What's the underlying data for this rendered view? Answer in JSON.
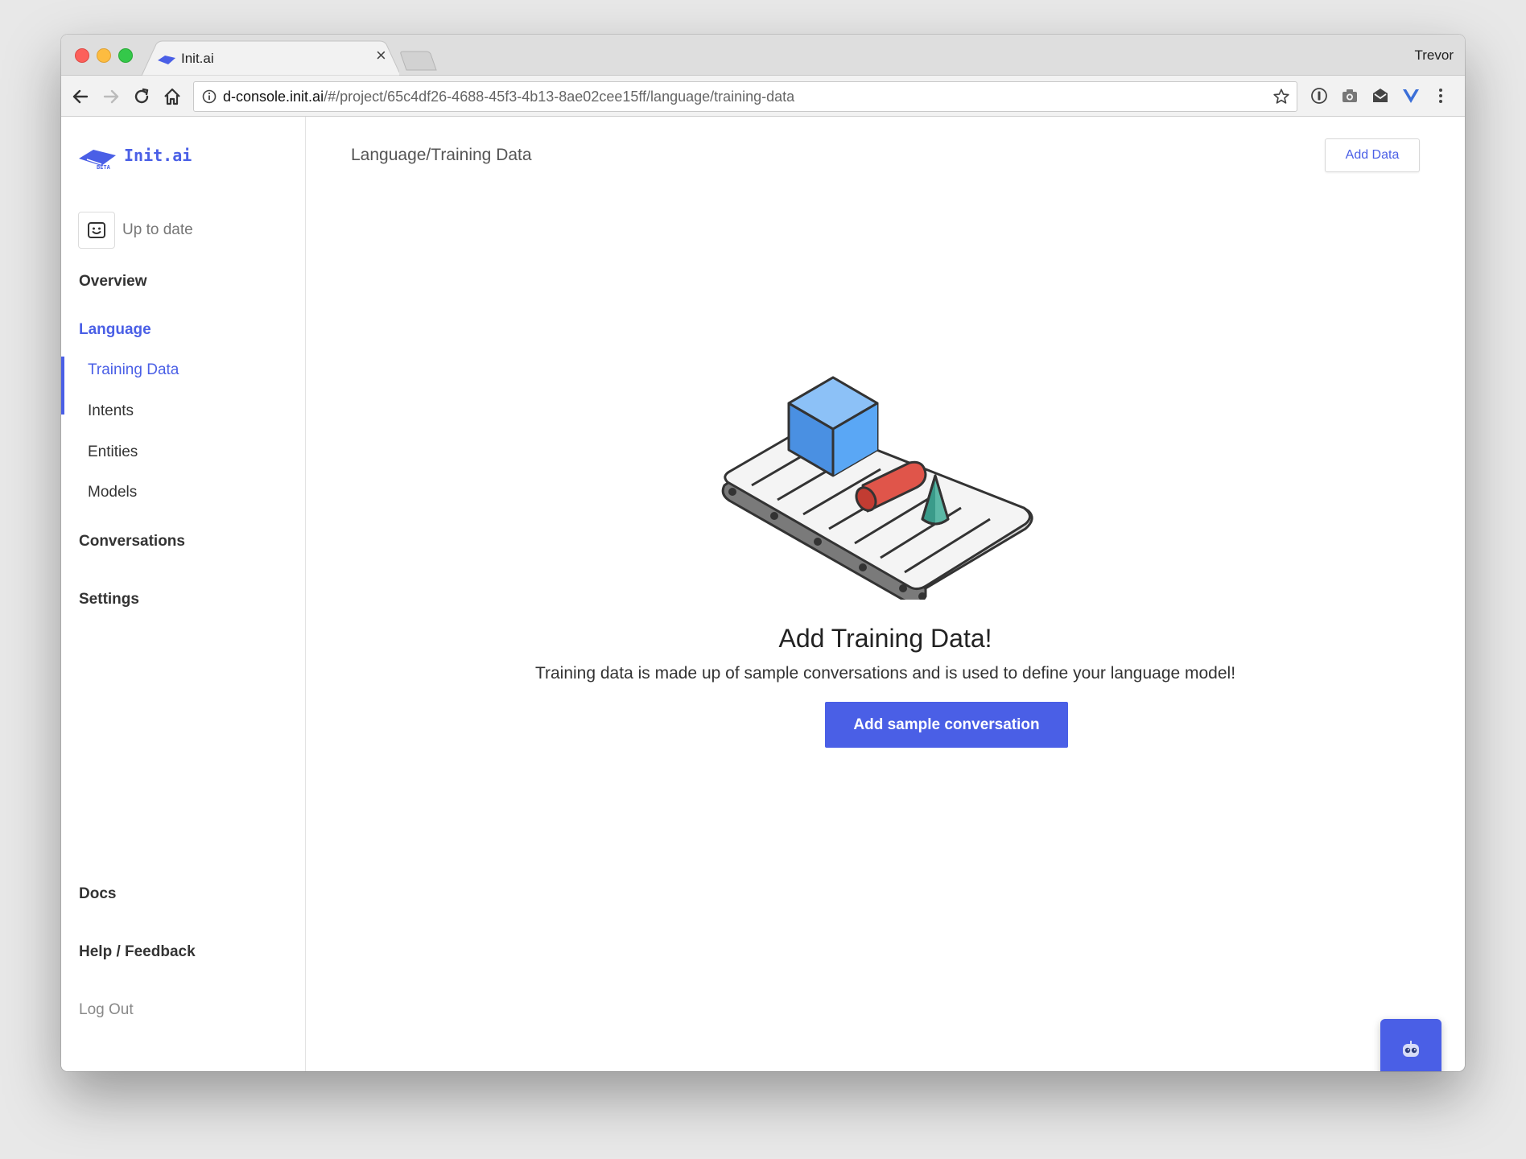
{
  "browser": {
    "tab_title": "Init.ai",
    "tab_close_glyph": "×",
    "profile_name": "Trevor",
    "url_host": "d-console.init.ai",
    "url_path": "/#/project/65c4df26-4688-45f3-4b13-8ae02cee15ff/language/training-data",
    "icons": [
      "back-icon",
      "forward-icon",
      "reload-icon",
      "home-icon",
      "info-icon",
      "star-icon",
      "1password-icon",
      "camera-icon",
      "mail-icon",
      "vue-devtools-icon",
      "menu-icon"
    ]
  },
  "sidebar": {
    "logo_text": "Init.ai",
    "logo_badge": "BETA",
    "status_text": "Up to date",
    "nav": {
      "overview": "Overview",
      "language": "Language",
      "training_data": "Training Data",
      "intents": "Intents",
      "entities": "Entities",
      "models": "Models",
      "conversations": "Conversations",
      "settings": "Settings",
      "docs": "Docs",
      "help": "Help / Feedback",
      "logout": "Log Out"
    }
  },
  "main": {
    "breadcrumb": "Language/Training Data",
    "add_data_label": "Add Data",
    "empty_title": "Add Training Data!",
    "empty_description": "Training data is made up of sample conversations and is used to define your language model!",
    "primary_button_label": "Add sample conversation"
  },
  "colors": {
    "accent": "#4a5fe6",
    "cube": "#4a90e2",
    "cylinder": "#e0554a",
    "cone": "#3a9b8a"
  }
}
